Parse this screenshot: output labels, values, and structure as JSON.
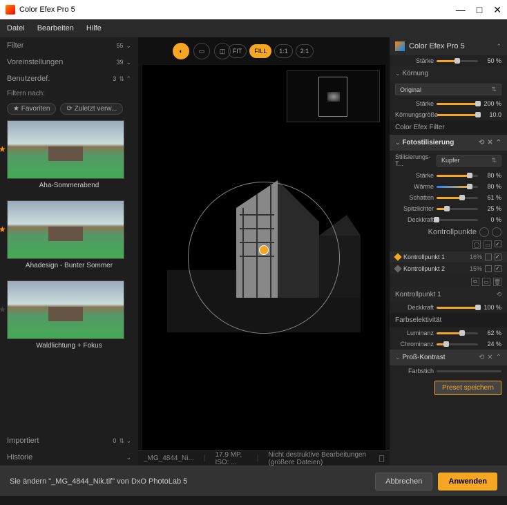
{
  "window": {
    "title": "Color Efex Pro 5",
    "minimize": "—",
    "maximize": "□",
    "close": "✕"
  },
  "menu": {
    "file": "Datei",
    "edit": "Bearbeiten",
    "help": "Hilfe"
  },
  "left": {
    "filter": {
      "label": "Filter",
      "count": "55"
    },
    "presets": {
      "label": "Voreinstellungen",
      "count": "39"
    },
    "custom": {
      "label": "Benutzerdef.",
      "count": "3"
    },
    "filterby": "Filtern nach:",
    "chip_fav": "★ Favoriten",
    "chip_recent": "⟳ Zuletzt verw...",
    "items": [
      {
        "label": "Aha-Sommerabend"
      },
      {
        "label": "Ahadesign - Bunter Sommer"
      },
      {
        "label": "Waldlichtung + Fokus"
      }
    ],
    "imported": {
      "label": "Importiert",
      "count": "0"
    },
    "history": {
      "label": "Historie"
    }
  },
  "toolbar": {
    "fit": "FIT",
    "fill": "FILL",
    "z11": "1:1",
    "z21": "2:1"
  },
  "status": {
    "filename": "_MG_4844_Ni...",
    "info": "17.9 MP, ISO: ...",
    "mode": "Nicht destruktive Bearbeitungen (größere Dateien)"
  },
  "right": {
    "title": "Color Efex Pro 5",
    "staerke": {
      "label": "Stärke",
      "value": "50 %",
      "pct": 50
    },
    "grain": {
      "header": "Körnung",
      "select": "Original",
      "staerke": {
        "label": "Stärke",
        "value": "200 %",
        "pct": 100
      },
      "size": {
        "label": "Körnungsgröße",
        "value": "10.0",
        "pct": 100
      }
    },
    "filterSection": "Color Efex Filter",
    "foto": {
      "header": "Fotostilisierung",
      "style_label": "Stilisierungs-T...",
      "style_value": "Kupfer",
      "sliders": {
        "staerke": {
          "label": "Stärke",
          "value": "80 %",
          "pct": 80
        },
        "waerme": {
          "label": "Wärme",
          "value": "80 %",
          "pct": 80
        },
        "schatten": {
          "label": "Schatten",
          "value": "61 %",
          "pct": 61
        },
        "spitz": {
          "label": "Spitzlichter",
          "value": "25 %",
          "pct": 25
        },
        "deck": {
          "label": "Deckkraft",
          "value": "0 %",
          "pct": 0
        }
      },
      "kontrollpunkte": "Kontrollpunkte",
      "kp": [
        {
          "name": "Kontrollpunkt 1",
          "pct": "16%"
        },
        {
          "name": "Kontrollpunkt 2",
          "pct": "15%"
        }
      ]
    },
    "kp_section": {
      "header": "Kontrollpunkt 1",
      "deck": {
        "label": "Deckkraft",
        "value": "100 %",
        "pct": 100
      },
      "farbsel": "Farbselektivität",
      "lum": {
        "label": "Luminanz",
        "value": "62 %",
        "pct": 62
      },
      "chrom": {
        "label": "Chrominanz",
        "value": "24 %",
        "pct": 24
      }
    },
    "prokontrast": "Proß-Kontrast",
    "farbstich": "Farbstich",
    "preset_save": "Preset speichern"
  },
  "footer": {
    "message": "Sie ändern \"_MG_4844_Nik.tif\" von DxO PhotoLab 5",
    "cancel": "Abbrechen",
    "apply": "Anwenden"
  }
}
